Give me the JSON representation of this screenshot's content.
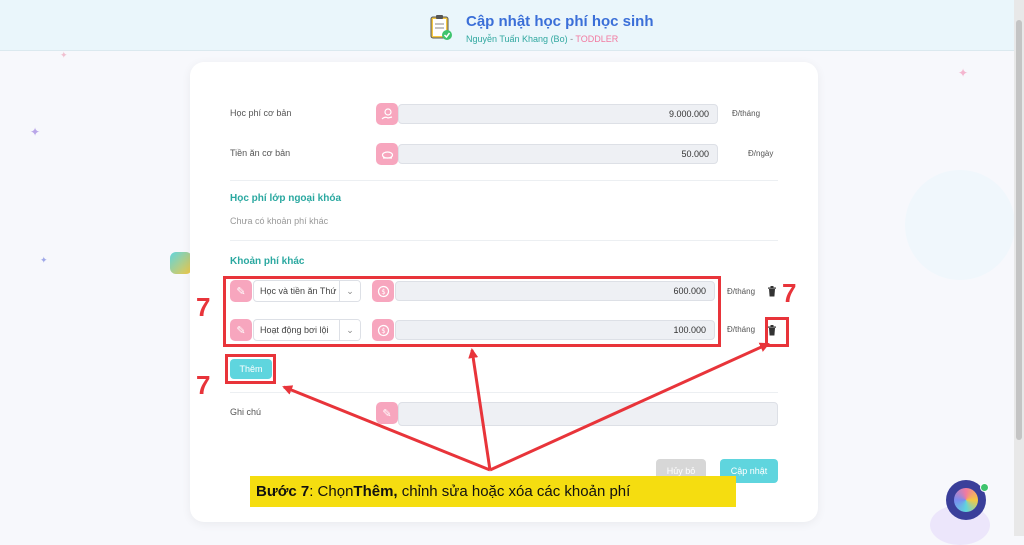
{
  "header": {
    "title": "Cập nhật học phí học sinh",
    "student": "Nguyễn Tuấn Khang (Bo)",
    "separator": " - ",
    "class_name": "TODDLER"
  },
  "basic": {
    "tuition_label": "Học phí cơ bản",
    "tuition_value": "9.000.000",
    "tuition_unit": "Đ/tháng",
    "meal_label": "Tiền ăn cơ bản",
    "meal_value": "50.000",
    "meal_unit": "Đ/ngày"
  },
  "extra_class": {
    "title": "Học phí lớp ngoại khóa",
    "empty_text": "Chưa có khoản phí khác"
  },
  "other_fees": {
    "title": "Khoản phí khác",
    "items": [
      {
        "name": "Học và tiền ăn Thứ",
        "amount": "600.000",
        "unit": "Đ/tháng"
      },
      {
        "name": "Hoạt động bơi lội",
        "amount": "100.000",
        "unit": "Đ/tháng"
      }
    ],
    "add_label": "Thêm"
  },
  "note": {
    "label": "Ghi chú",
    "value": ""
  },
  "actions": {
    "cancel_label": "Hủy bỏ",
    "update_label": "Cập nhật"
  },
  "annotation": {
    "step_number": "7",
    "caption_prefix": "Bước 7",
    "caption_mid": ": Chọn ",
    "caption_bold": "Thêm,",
    "caption_rest": " chỉnh sửa hoặc xóa các khoản phí"
  },
  "colors": {
    "accent_teal": "#5fd5de",
    "accent_pink": "#f7a6be",
    "annotation_red": "#e8343a",
    "caption_yellow": "#f5dd10",
    "title_blue": "#3b6fd8"
  },
  "icons": [
    "clipboard-check-icon",
    "money-hand-icon",
    "food-icon",
    "pencil-icon",
    "coin-icon",
    "chevron-down-icon",
    "trash-icon",
    "chat-assistant-icon"
  ]
}
